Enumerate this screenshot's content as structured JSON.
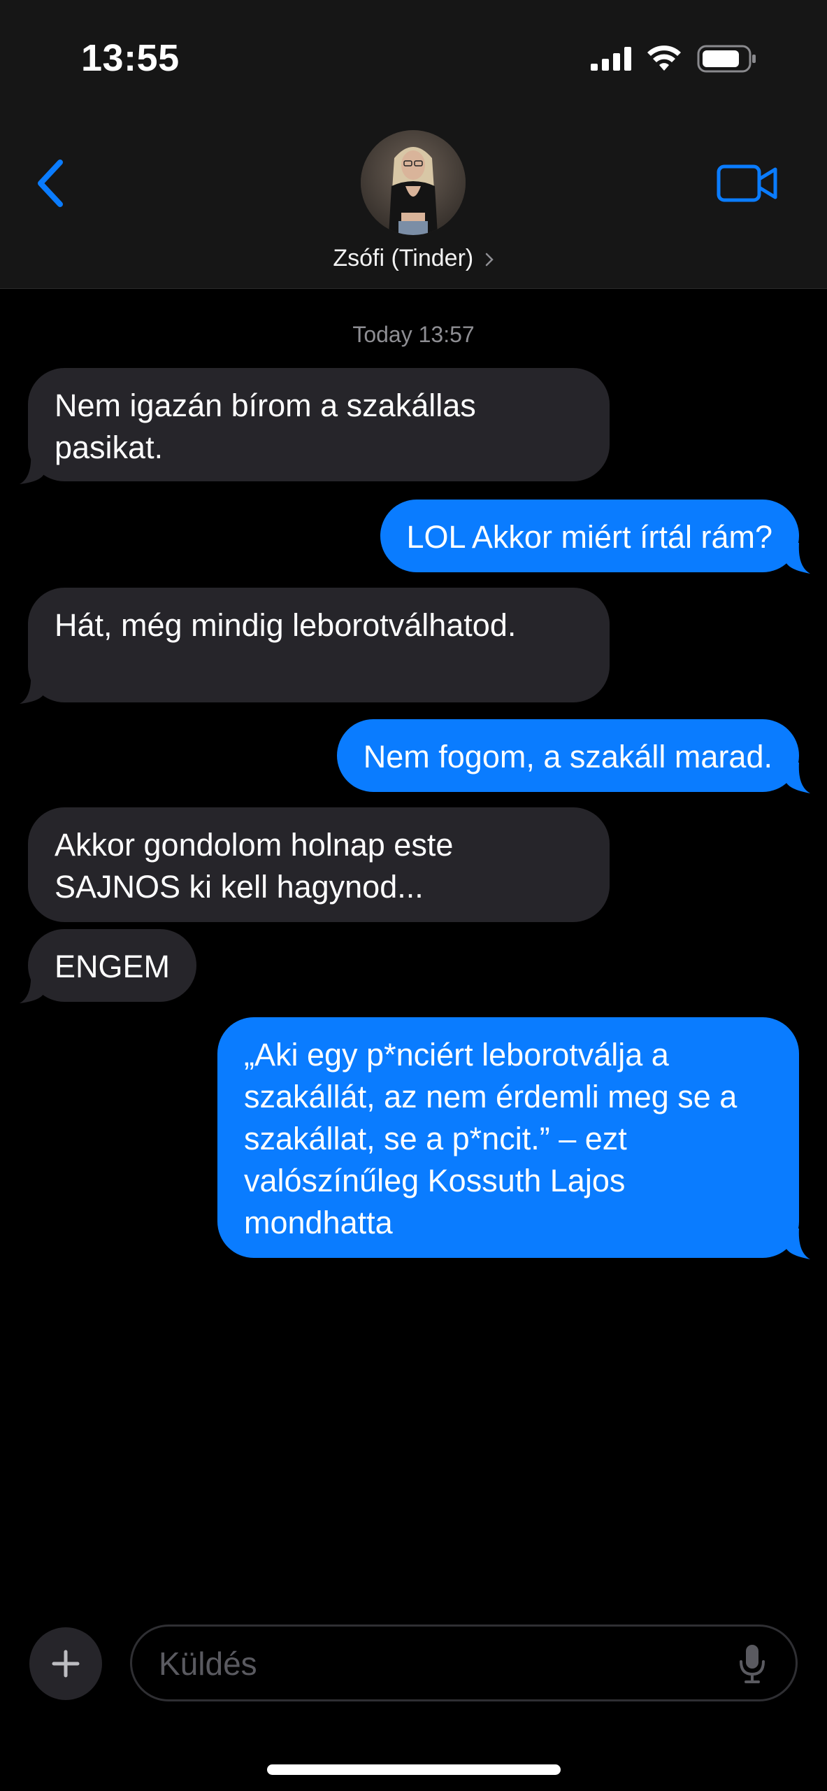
{
  "status_bar": {
    "time": "13:55"
  },
  "header": {
    "contact_name": "Zsófi (Tinder)",
    "icons": {
      "back": "chevron-left-icon",
      "video": "video-camera-icon",
      "disclosure": "chevron-right-icon"
    },
    "accent_color": "#0a7cff"
  },
  "conversation": {
    "timestamp": "Today 13:57",
    "messages": [
      {
        "direction": "incoming",
        "text": "Nem igazán bírom a szakállas pasikat."
      },
      {
        "direction": "outgoing",
        "text": "LOL Akkor miért írtál rám?"
      },
      {
        "direction": "incoming",
        "text": "Hát, még mindig leborotválhatod."
      },
      {
        "direction": "outgoing",
        "text": "Nem fogom, a szakáll marad."
      },
      {
        "direction": "incoming",
        "text": "Akkor gondolom holnap este SAJNOS ki kell hagynod..."
      },
      {
        "direction": "incoming",
        "text": "ENGEM"
      },
      {
        "direction": "outgoing",
        "text": "„Aki egy p*nciért leborotválja a szakállát, az nem érdemli meg se a szakállat, se a p*ncit.” –  ezt valószínűleg Kossuth Lajos mondhatta"
      }
    ]
  },
  "composer": {
    "placeholder": "Küldés",
    "value": "",
    "icons": {
      "add": "plus-icon",
      "mic": "microphone-icon"
    }
  },
  "colors": {
    "incoming_bubble": "#26252a",
    "outgoing_bubble": "#0a7cff",
    "background": "#000000",
    "header_background": "#161616"
  }
}
